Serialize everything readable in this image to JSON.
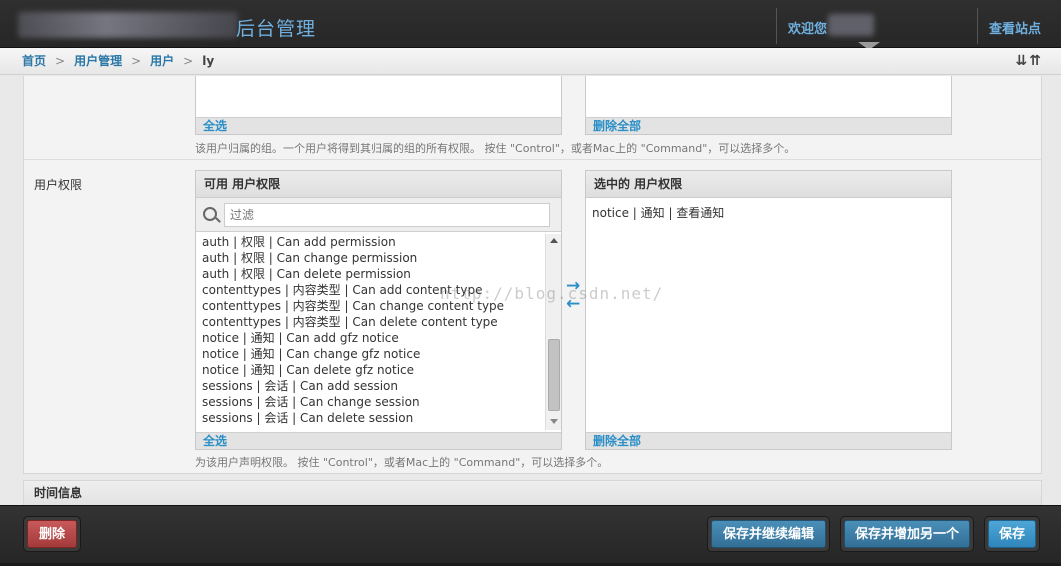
{
  "header": {
    "site_title": "后台管理",
    "welcome": "欢迎您",
    "view_site": "查看站点"
  },
  "breadcrumb": {
    "items": [
      "首页",
      "用户管理",
      "用户",
      "ly"
    ],
    "separator": ">",
    "tools": "⇊⇈"
  },
  "groups": {
    "select_all": "全选",
    "remove_all": "删除全部",
    "help": "该用户归属的组。一个用户将得到其归属的组的所有权限。 按住 \"Control\"，或者Mac上的 \"Command\"，可以选择多个。"
  },
  "permissions": {
    "label": "用户权限",
    "available_title": "可用 用户权限",
    "filter_placeholder": "过滤",
    "available": [
      "auth | 权限 | Can add permission",
      "auth | 权限 | Can change permission",
      "auth | 权限 | Can delete permission",
      "contenttypes | 内容类型 | Can add content type",
      "contenttypes | 内容类型 | Can change content type",
      "contenttypes | 内容类型 | Can delete content type",
      "notice | 通知 | Can add gfz notice",
      "notice | 通知 | Can change gfz notice",
      "notice | 通知 | Can delete gfz notice",
      "sessions | 会话 | Can add session",
      "sessions | 会话 | Can change session",
      "sessions | 会话 | Can delete session"
    ],
    "select_all": "全选",
    "chosen_title": "选中的 用户权限",
    "chosen": [
      "notice | 通知 | 查看通知"
    ],
    "remove_all": "删除全部",
    "add_arrow": "→",
    "remove_arrow": "←",
    "help": "为该用户声明权限。 按住 \"Control\"，或者Mac上的 \"Command\"，可以选择多个。"
  },
  "watermark": "http://blog.csdn.net/",
  "time_section": {
    "title": "时间信息"
  },
  "submit_row": {
    "delete": "删除",
    "save_continue": "保存并继续编辑",
    "save_add_another": "保存并增加另一个",
    "save": "保存"
  },
  "colors": {
    "link": "#2b78a8",
    "accent": "#2b8fc7",
    "delete_button": "#b84a4a",
    "header_bg": "#2b2b2b"
  }
}
